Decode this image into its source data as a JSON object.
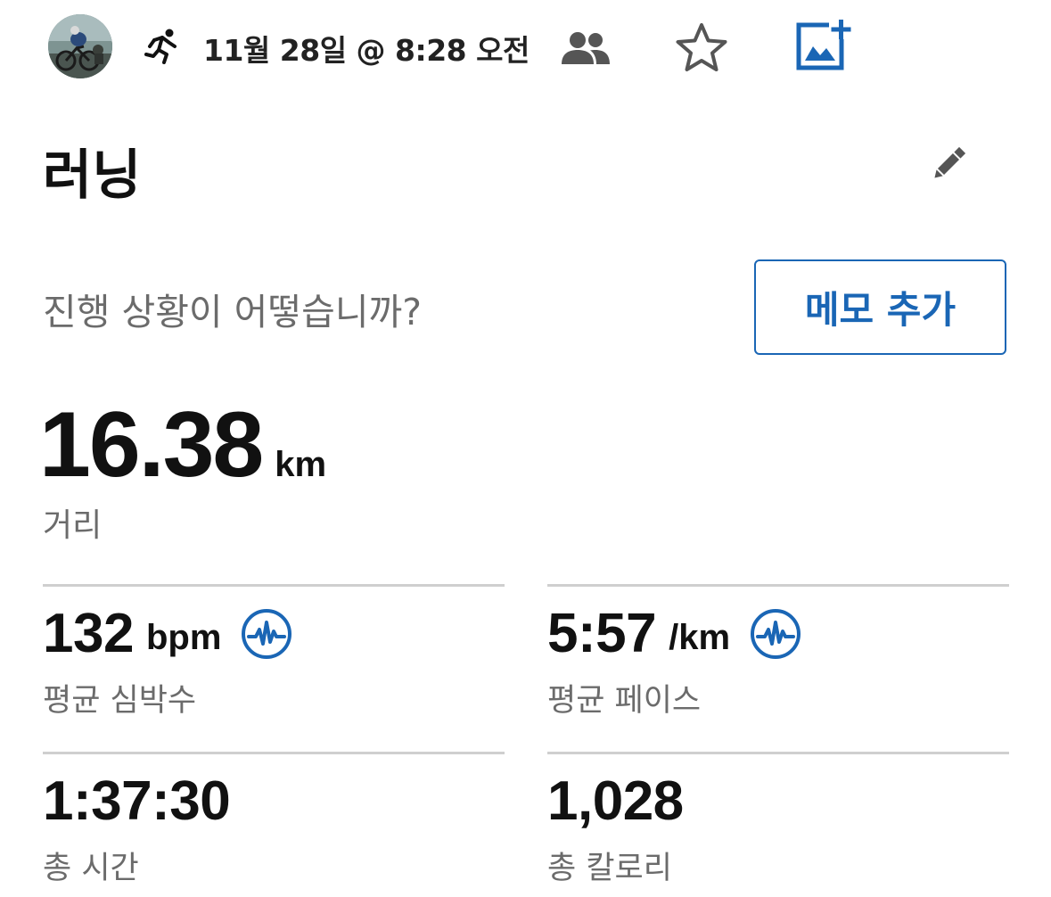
{
  "header": {
    "datetime": "11월 28일 @ 8:28 오전",
    "avatar_icon": "avatar-photo",
    "activity_icon": "running-person-icon",
    "people_icon": "people-icon",
    "star_icon": "star-outline-icon",
    "add_photo_icon": "add-photo-icon"
  },
  "activity": {
    "title": "러닝",
    "edit_icon": "pencil-icon"
  },
  "notes": {
    "prompt": "진행 상황이 어떻습니까?",
    "add_button_label": "메모 추가"
  },
  "distance": {
    "value": "16.38",
    "unit": "km",
    "label": "거리"
  },
  "stats": [
    {
      "value": "132",
      "unit": "bpm",
      "label": "평균 심박수",
      "has_badge": true
    },
    {
      "value": "5:57",
      "unit": "/km",
      "label": "평균 페이스",
      "has_badge": true
    },
    {
      "value": "1:37:30",
      "unit": "",
      "label": "총 시간",
      "has_badge": false
    },
    {
      "value": "1,028",
      "unit": "",
      "label": "총 칼로리",
      "has_badge": false
    }
  ],
  "colors": {
    "accent": "#1a66b5",
    "text_primary": "#111111",
    "text_secondary": "#6b6b6b",
    "divider": "#cfcfcf",
    "icon_gray": "#555555"
  }
}
